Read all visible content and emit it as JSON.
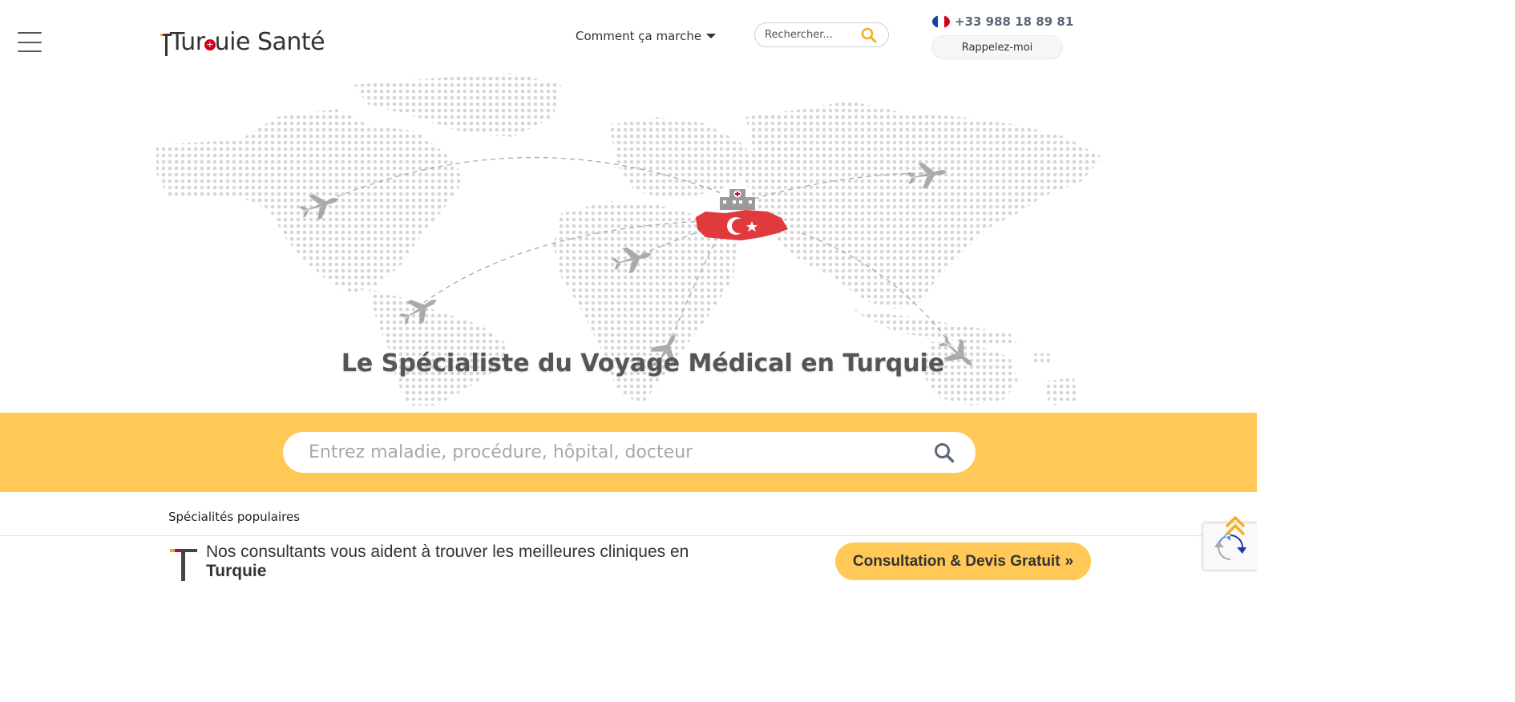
{
  "header": {
    "logo_text_1": "Tur",
    "logo_text_2": "uie Santé",
    "nav_how": "Comment ça marche",
    "search_placeholder": "Rechercher...",
    "phone": "+33 988 18 89 81",
    "callback_label": "Rappelez-moi"
  },
  "hero": {
    "title": "Le Spécialiste du Voyage Médical en Turquie"
  },
  "search": {
    "placeholder": "Entrez maladie, procédure, hôpital, docteur"
  },
  "popular": {
    "heading": "Spécialités populaires"
  },
  "bottom_bar": {
    "line1": "Nos consultants vous aident à trouver les meilleures cliniques en",
    "line2": "Turquie",
    "cta_label": "Consultation & Devis Gratuit",
    "cta_arrows": "»"
  },
  "colors": {
    "accent": "#ffc857",
    "turkey_red": "#e0393e",
    "map_dots": "#d6d6d6",
    "phone_text": "#5b6778"
  },
  "icons": {
    "menu": "hamburger-icon",
    "search": "search-icon",
    "flag": "flag-fr-icon",
    "hospital": "hospital-icon",
    "plane": "plane-icon",
    "scroll_top": "chevron-up-icon",
    "recaptcha": "recaptcha-icon"
  }
}
